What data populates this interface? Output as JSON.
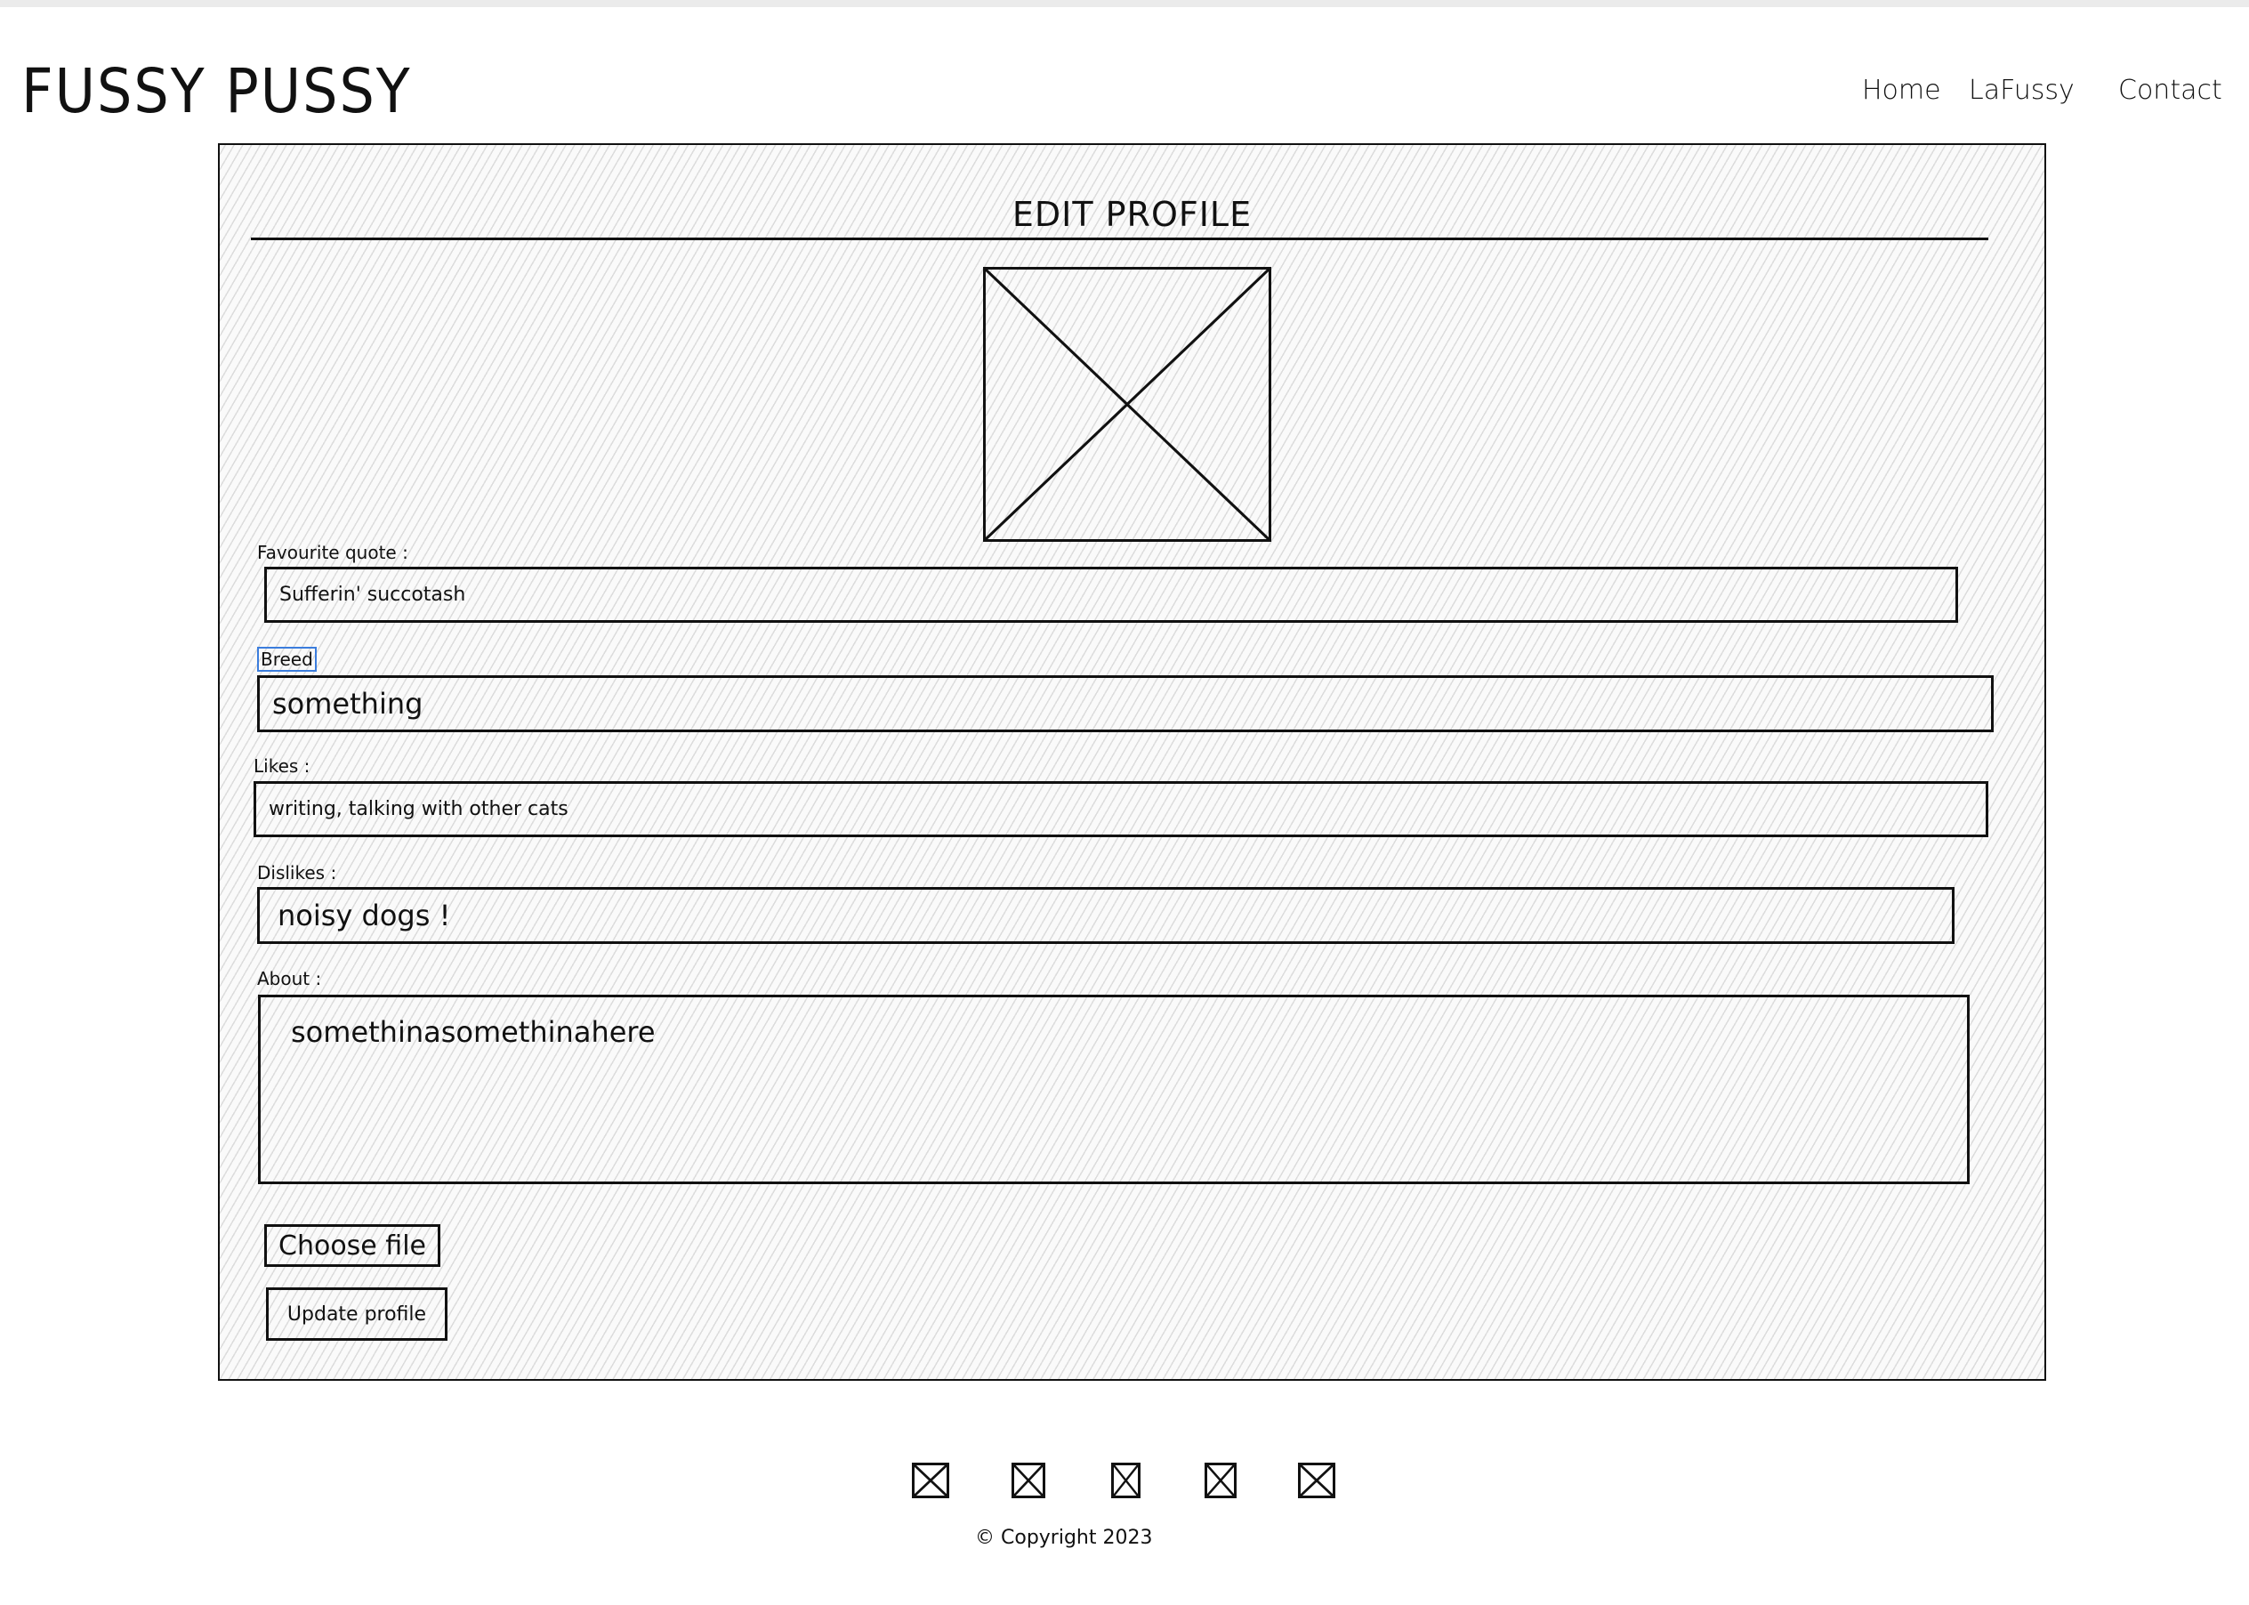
{
  "header": {
    "brand": "FUSSY PUSSY",
    "nav": [
      {
        "label": "Home"
      },
      {
        "label": "LaFussy"
      },
      {
        "label": "Contact"
      }
    ]
  },
  "form": {
    "title": "EDIT PROFILE",
    "image_icon": "image-placeholder-icon",
    "favourite_quote": {
      "label": "Favourite quote :",
      "value": "Sufferin' succotash"
    },
    "breed": {
      "label": "Breed",
      "value": "something"
    },
    "likes": {
      "label": "Likes :",
      "value": "writing, talking with other cats"
    },
    "dislikes": {
      "label": "Dislikes :",
      "value": "noisy dogs !"
    },
    "about": {
      "label": "About :",
      "value": "somethinasomethinahere"
    },
    "choose_file": "Choose file",
    "update_profile": "Update profile"
  },
  "footer": {
    "social_icons": [
      "image-placeholder-icon",
      "image-placeholder-icon",
      "image-placeholder-icon",
      "image-placeholder-icon",
      "image-placeholder-icon"
    ],
    "copyright": "© Copyright 2023"
  },
  "colors": {
    "focus": "#3b7ddd",
    "ink": "#111111"
  }
}
